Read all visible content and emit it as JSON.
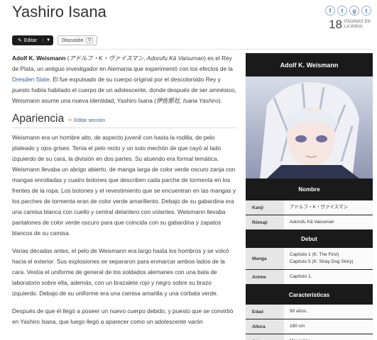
{
  "page": {
    "title": "Yashiro Isana"
  },
  "header": {
    "social": [
      "f",
      "t",
      "g",
      "t"
    ],
    "pages_count": "18",
    "pages_label": "PÁGINAS EN LA WIKIA"
  },
  "toolbar": {
    "edit_label": "Editar",
    "discussion_label": "Discusión",
    "discussion_count": "0"
  },
  "intro": {
    "name": "Adolf K. Weismann",
    "jp": "アドルフ・K・ヴァイスマン",
    "romaji": "Adorufu Kā Vaisuman",
    "t1": " es el Rey de Plata, un antiguo investigador en Alemania que experimentó con los efectos de la ",
    "link": "Dresden Slate",
    "t2": ". Él fue expulsado de su cuerpo original por el descoloroido Rey y puesto había habitado el cuerpo de un adolescente, donde después de ser amnésico, Weismann asume una nueva identidad, Yashiro Isana (",
    "jp2": "伊佐那社, Isana Yashiro",
    "t3": ")."
  },
  "section": {
    "heading": "Apariencia",
    "edit": "Editar sección"
  },
  "paragraphs": [
    "Weismann era un hombre alto, de aspecto juvenil con hasta la rodilla, de pelo plateado y ojos grises. Tenía el pelo recto y un solo mechón de que cayó al lado izquierdo de su cara, la división en dos partes. Su atuendo era formal temática. Weismann llevaba un abrigo abierto, de manga larga de color verde oscuro zanja con mangas enrolladas y cuatro botones que describen cada parche de tormenta en los frentes de la ropa. Los botones y el revestimiento que se encuentran en las mangas y los parches de tormenta eran de color verde amarillento. Debajo de su gabardina era una camisa blanca con cuello y central delantero con volantes. Weismann llevaba pantalones de color verde oscuro para que coincida con su gabardina y zapatos blancos de su camisa.",
    "Varias décadas antes, el pelo de Weismann era largo hasta los hombros y se volcó hacia el exterior. Sus explosiones se separaron para enmarcar ambos lados de la cara. Vestía el uniforme de general de los soldados alemanes con una bata de laboratorio sobre ella, además, con un brazalete rojo y negro sobre su brazo izquierdo. Debajo de su uniforme era una camisa amarilla y una corbata verde.",
    "Después de que él llegó a poseer un nuevo cuerpo debido, y puesto que se convirtió en Yashiro Isana, que luego llegó a aparecer como un adolescente varón"
  ],
  "infobox": {
    "title": "Adolf K. Weismann",
    "s1": "Nombre",
    "kanji_k": "Kanji",
    "kanji_v": "アドルフ・K・ヴァイスマン",
    "romaji_k": "Rōmaji",
    "romaji_v": "Adorufu Kā Vaisuman",
    "s2": "Debut",
    "manga_k": "Manga",
    "manga_v1": "Capítulo 1 (K: The First)",
    "manga_v2": "Capítulo 5 (K: Stray Dog Story)",
    "anime_k": "Anime",
    "anime_v": "Capítulo 1.",
    "s3": "Características",
    "edad_k": "Edad",
    "edad_v": "90 años.",
    "altura_k": "Altura",
    "altura_v": "180 cm",
    "genero_k": "Género",
    "genero_v": "Masculino"
  }
}
